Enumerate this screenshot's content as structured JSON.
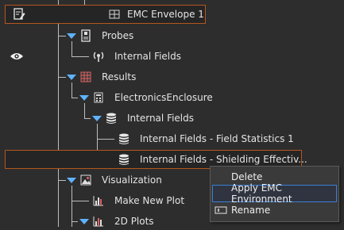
{
  "tree": {
    "items": [
      {
        "label": "EMC Envelope 1"
      },
      {
        "label": "Probes"
      },
      {
        "label": "Internal Fields"
      },
      {
        "label": "Results"
      },
      {
        "label": "ElectronicsEnclosure"
      },
      {
        "label": "Internal Fields"
      },
      {
        "label": "Internal Fields - Field Statistics 1"
      },
      {
        "label": "Internal Fields - Shielding Effectiv..."
      },
      {
        "label": "Visualization"
      },
      {
        "label": "Make New Plot"
      },
      {
        "label": "2D Plots"
      }
    ]
  },
  "context_menu": {
    "items": [
      {
        "label": "Delete"
      },
      {
        "label": "Apply EMC Environment"
      },
      {
        "label": "Rename"
      }
    ]
  },
  "colors": {
    "background": "#2d2d2d",
    "selection_outline": "#b4561f",
    "expander": "#5fb2ff",
    "menu_highlight": "#3c7fd6"
  }
}
